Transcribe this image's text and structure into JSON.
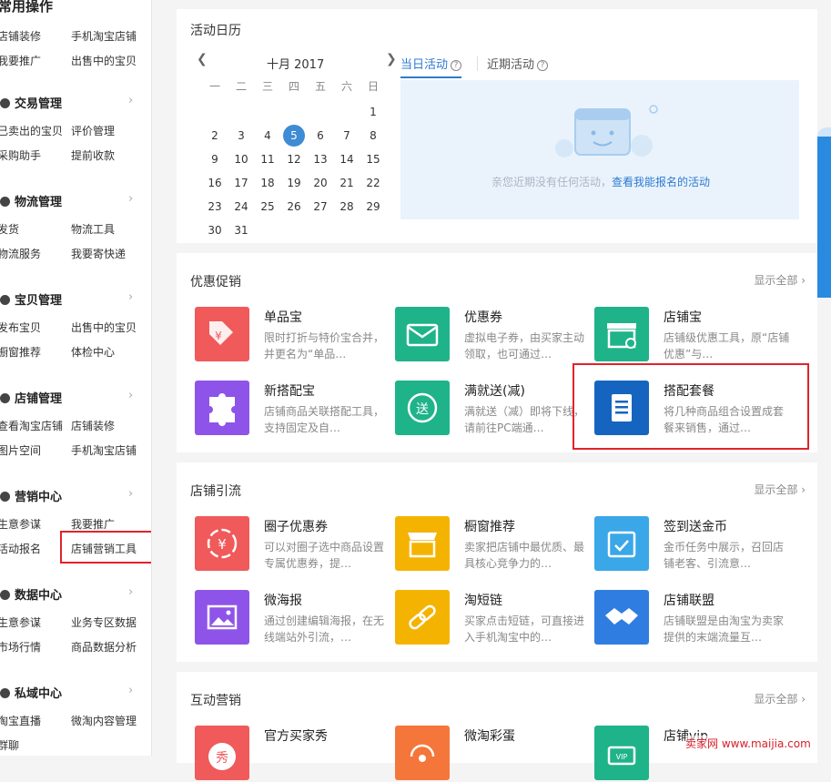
{
  "sidebar": {
    "top_title": "常用操作",
    "top_links": [
      "店铺装修",
      "手机淘宝店铺",
      "我要推广",
      "出售中的宝贝"
    ],
    "sections": [
      {
        "title": "交易管理",
        "links": [
          "已卖出的宝贝",
          "评价管理",
          "采购助手",
          "提前收款"
        ]
      },
      {
        "title": "物流管理",
        "links": [
          "发货",
          "物流工具",
          "物流服务",
          "我要寄快递"
        ]
      },
      {
        "title": "宝贝管理",
        "links": [
          "发布宝贝",
          "出售中的宝贝",
          "橱窗推荐",
          "体检中心"
        ]
      },
      {
        "title": "店铺管理",
        "links": [
          "查看淘宝店铺",
          "店铺装修",
          "图片空间",
          "手机淘宝店铺"
        ]
      },
      {
        "title": "营销中心",
        "links": [
          "生意参谋",
          "我要推广",
          "活动报名",
          "店铺营销工具"
        ]
      },
      {
        "title": "数据中心",
        "links": [
          "生意参谋",
          "业务专区数据",
          "市场行情",
          "商品数据分析"
        ]
      },
      {
        "title": "私域中心",
        "links": [
          "淘宝直播",
          "微淘内容管理",
          "群聊"
        ]
      }
    ]
  },
  "calendar_panel": {
    "title": "活动日历",
    "month_label": "十月  2017",
    "weekdays": [
      "一",
      "二",
      "三",
      "四",
      "五",
      "六",
      "日"
    ],
    "days": [
      [
        "",
        "",
        "",
        "",
        "",
        "",
        "1"
      ],
      [
        "2",
        "3",
        "4",
        "5",
        "6",
        "7",
        "8"
      ],
      [
        "9",
        "10",
        "11",
        "12",
        "13",
        "14",
        "15"
      ],
      [
        "16",
        "17",
        "18",
        "19",
        "20",
        "21",
        "22"
      ],
      [
        "23",
        "24",
        "25",
        "26",
        "27",
        "28",
        "29"
      ],
      [
        "30",
        "31",
        "",
        "",
        "",
        "",
        ""
      ]
    ],
    "today": "5",
    "prev_icon": "chevron-left-icon",
    "next_icon": "chevron-right-icon",
    "tab_today": "当日活动",
    "tab_recent": "近期活动",
    "empty_text": "亲您近期没有任何活动，",
    "empty_link": "查看我能报名的活动"
  },
  "promo_panel": {
    "title": "优惠促销",
    "view_all": "显示全部",
    "tools": [
      {
        "name": "单品宝",
        "desc": "限时打折与特价宝合并，并更名为“单品…",
        "color": "#f05a5a",
        "icon": "price-tag-icon"
      },
      {
        "name": "优惠券",
        "desc": "虚拟电子券，由买家主动领取，也可通过…",
        "color": "#1fb38a",
        "icon": "coupon-envelope-icon"
      },
      {
        "name": "店铺宝",
        "desc": "店铺级优惠工具，原“店铺优惠”与…",
        "color": "#1fb38a",
        "icon": "shop-gear-icon"
      },
      {
        "name": "新搭配宝",
        "desc": "店铺商品关联搭配工具，支持固定及自…",
        "color": "#8e54e9",
        "icon": "puzzle-icon"
      },
      {
        "name": "满就送(减)",
        "desc": "满就送（减）即将下线，请前往PC端通…",
        "color": "#1fb38a",
        "icon": "gift-send-icon"
      },
      {
        "name": "搭配套餐",
        "desc": "将几种商品组合设置成套餐来销售，通过…",
        "color": "#1565c0",
        "icon": "document-list-icon"
      }
    ]
  },
  "traffic_panel": {
    "title": "店铺引流",
    "view_all": "显示全部",
    "tools": [
      {
        "name": "圈子优惠券",
        "desc": "可以对圈子选中商品设置专属优惠券，提…",
        "color": "#f05a5a",
        "icon": "circle-coupon-icon"
      },
      {
        "name": "橱窗推荐",
        "desc": "卖家把店铺中最优质、最具核心竞争力的…",
        "color": "#f5b301",
        "icon": "storefront-icon"
      },
      {
        "name": "签到送金币",
        "desc": "金币任务中展示，召回店铺老客、引流意…",
        "color": "#3aa7e8",
        "icon": "calendar-check-icon"
      },
      {
        "name": "微海报",
        "desc": "通过创建编辑海报，在无线端站外引流，…",
        "color": "#8e54e9",
        "icon": "image-poster-icon"
      },
      {
        "name": "淘短链",
        "desc": "买家点击短链，可直接进入手机淘宝中的…",
        "color": "#f5b301",
        "icon": "link-icon"
      },
      {
        "name": "店铺联盟",
        "desc": "店铺联盟是由淘宝为卖家提供的末端流量互…",
        "color": "#2f7de1",
        "icon": "handshake-icon"
      }
    ]
  },
  "interact_panel": {
    "title": "互动营销",
    "view_all": "显示全部",
    "tools": [
      {
        "name": "官方买家秀",
        "desc": "",
        "color": "#f05a5a",
        "icon": "show-icon"
      },
      {
        "name": "微淘彩蛋",
        "desc": "",
        "color": "#f5763a",
        "icon": "egg-signal-icon"
      },
      {
        "name": "店铺vip",
        "desc": "",
        "color": "#1fb38a",
        "icon": "vip-card-icon"
      }
    ]
  },
  "watermark": "卖家网 www.maijia.com"
}
